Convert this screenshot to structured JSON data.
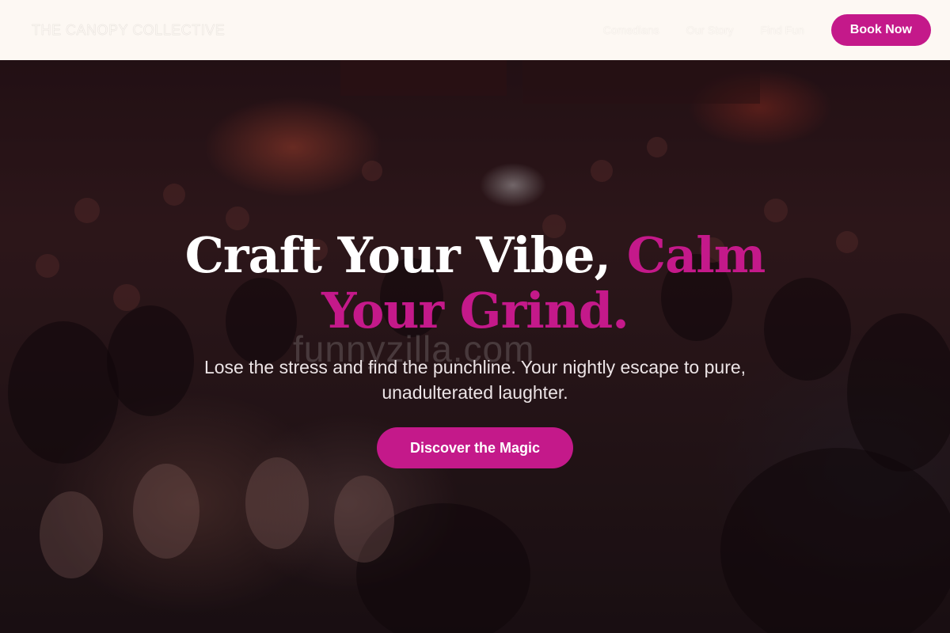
{
  "nav": {
    "brand": "THE CANOPY COLLECTIVE",
    "links": [
      "Comedians",
      "Our Story",
      "Find Fun"
    ],
    "book_label": "Book Now"
  },
  "hero": {
    "headline_white": "Craft Your Vibe, ",
    "headline_accent": "Calm Your Grind.",
    "subtext": "Lose the stress and find the punchline. Your nightly escape to pure, unadulterated laughter.",
    "cta_label": "Discover the Magic",
    "watermark": "funnyzilla.com"
  },
  "colors": {
    "accent": "#c4198a",
    "navbar_bg": "#fdf8f3",
    "text_light": "#ffffff"
  }
}
